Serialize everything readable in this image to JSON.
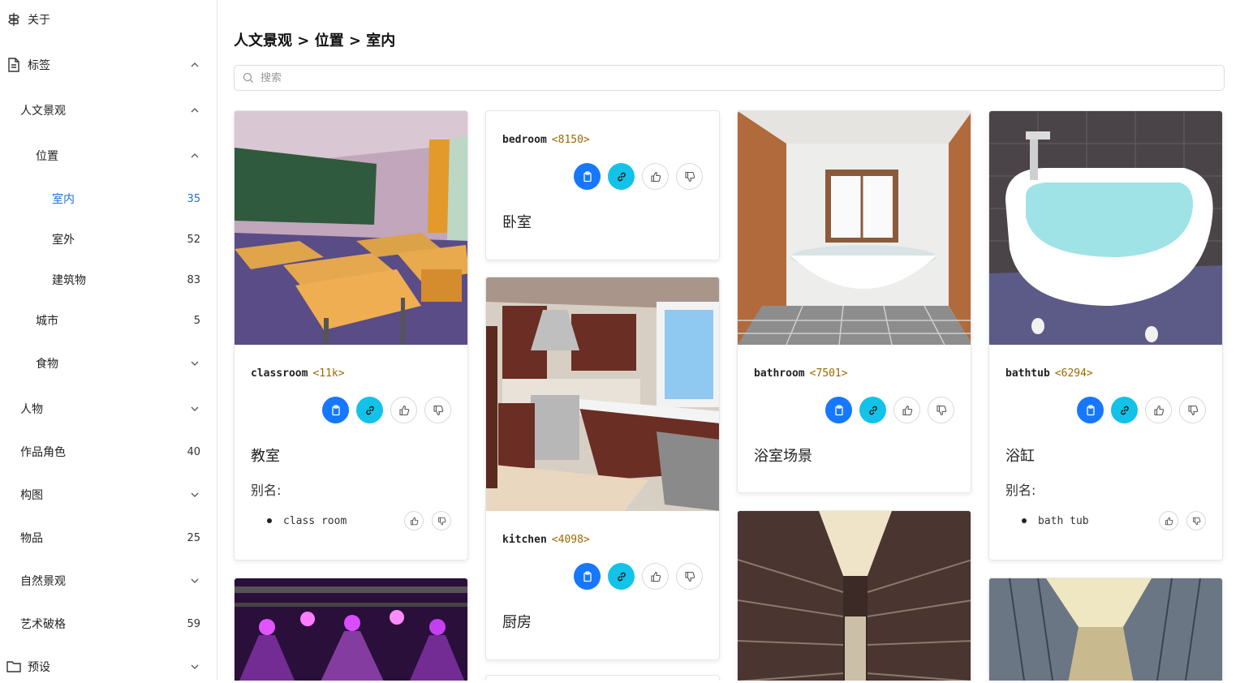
{
  "sidebar": {
    "items": [
      {
        "label": "关于",
        "icon": "signpost-icon"
      },
      {
        "label": "标签",
        "icon": "document-icon",
        "chevron": "up"
      },
      {
        "label": "人文景观",
        "chevron": "up"
      },
      {
        "label": "位置",
        "chevron": "up"
      },
      {
        "label": "室内",
        "count": "35",
        "active": true
      },
      {
        "label": "室外",
        "count": "52"
      },
      {
        "label": "建筑物",
        "count": "83"
      },
      {
        "label": "城市",
        "count": "5"
      },
      {
        "label": "食物",
        "chevron": "down"
      },
      {
        "label": "人物",
        "chevron": "down"
      },
      {
        "label": "作品角色",
        "count": "40"
      },
      {
        "label": "构图",
        "chevron": "down"
      },
      {
        "label": "物品",
        "count": "25"
      },
      {
        "label": "自然景观",
        "chevron": "down"
      },
      {
        "label": "艺术破格",
        "count": "59"
      },
      {
        "label": "预设",
        "icon": "folder-icon",
        "chevron": "down"
      }
    ]
  },
  "header": {
    "breadcrumb": "人文景观 > 位置 > 室内"
  },
  "search": {
    "placeholder": "搜索"
  },
  "colors": {
    "accent": "#1f6fd1",
    "copy_button": "#1677ff",
    "link_button": "#13c2e8",
    "count_text": "#9a6a00"
  },
  "cards": [
    {
      "tag": "classroom",
      "count": "<11k>",
      "name": "教室",
      "alias_label": "别名:",
      "aliases": [
        "class room"
      ]
    },
    {
      "tag": "bedroom",
      "count": "<8150>",
      "name": "卧室"
    },
    {
      "tag": "kitchen",
      "count": "<4098>",
      "name": "厨房"
    },
    {
      "tag": "bathroom",
      "count": "<7501>",
      "name": "浴室场景"
    },
    {
      "tag": "bathtub",
      "count": "<6294>",
      "name": "浴缸",
      "alias_label": "别名:",
      "aliases": [
        "bath tub"
      ]
    }
  ]
}
